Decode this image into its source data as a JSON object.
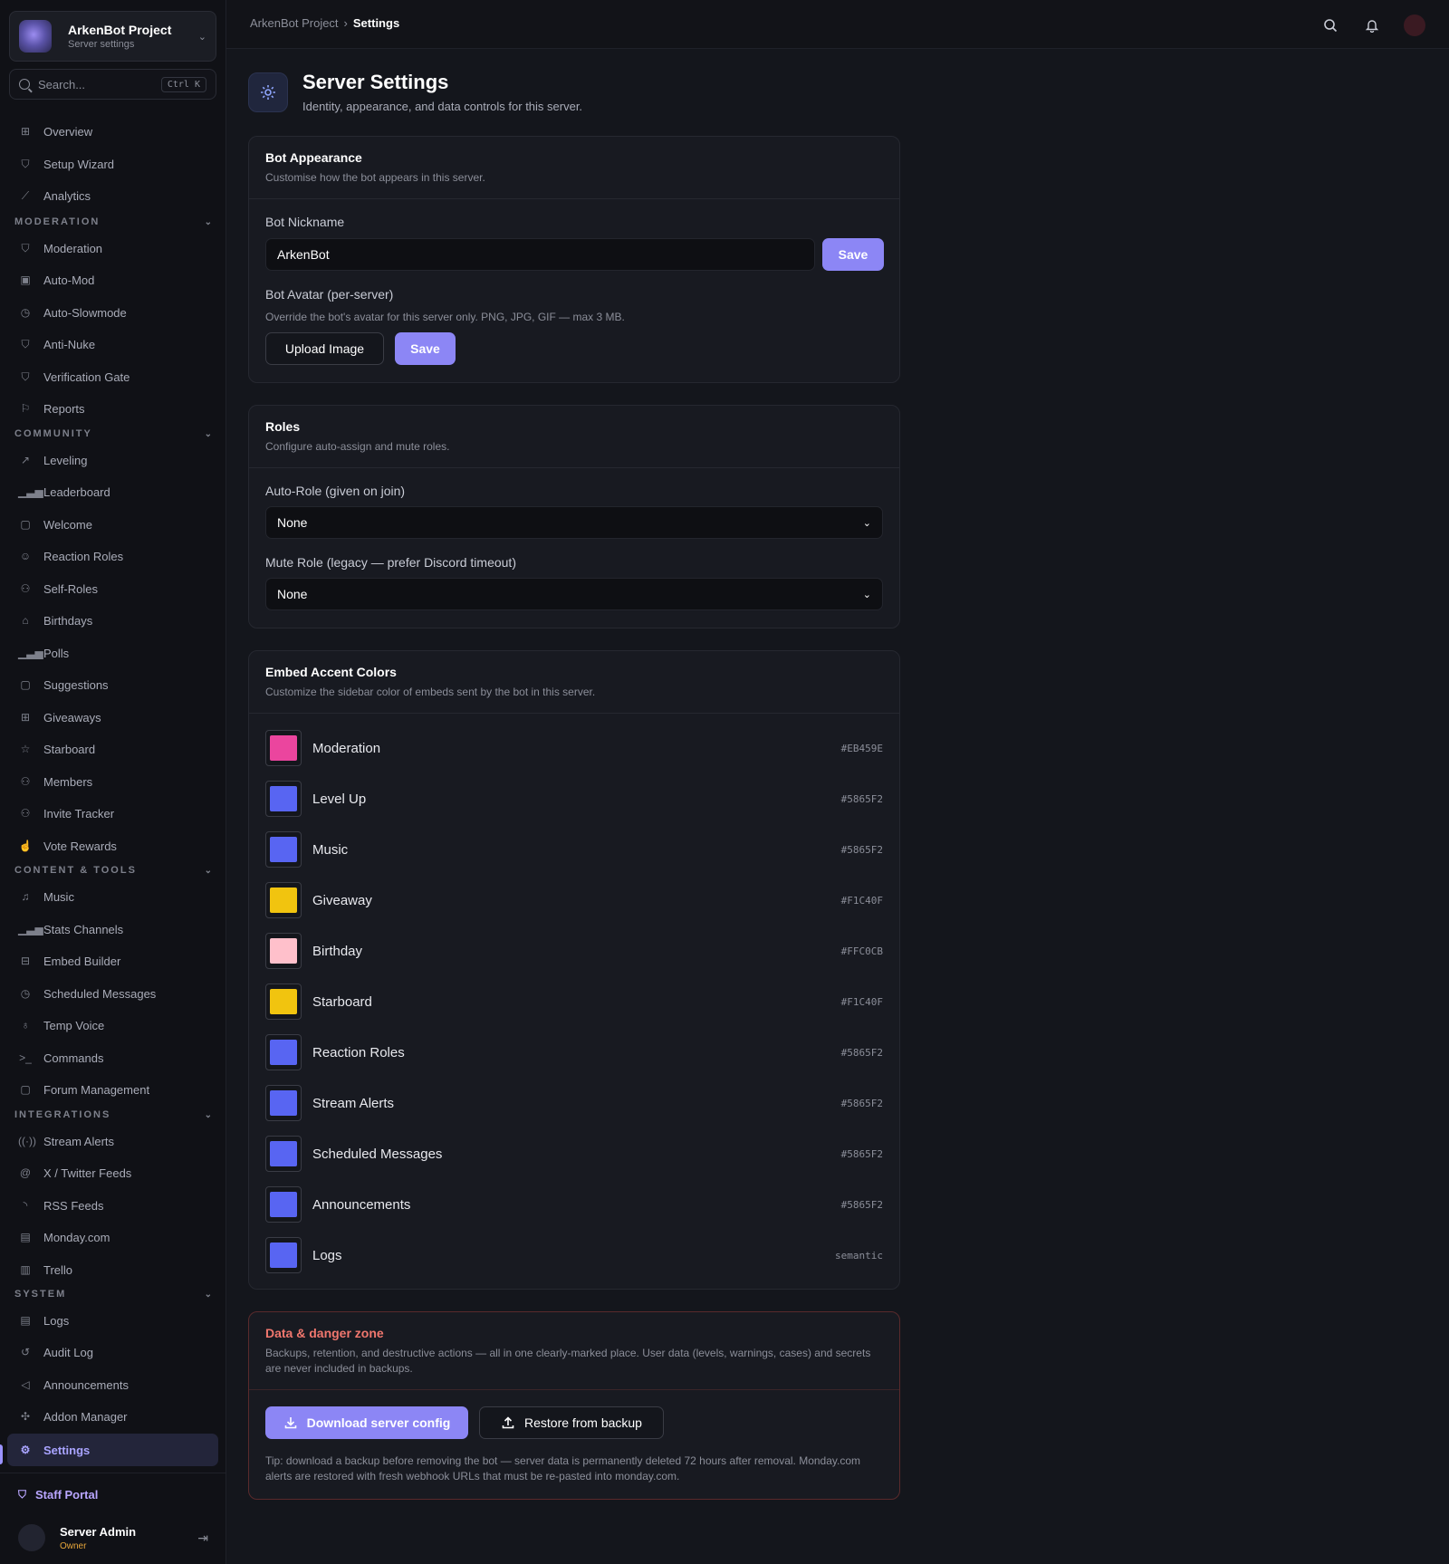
{
  "sidebar": {
    "project_name": "ArkenBot Project",
    "project_sub": "Server settings",
    "search_placeholder": "Search...",
    "search_shortcut": "Ctrl K",
    "top_items": [
      {
        "label": "Overview",
        "icon": "grid-icon"
      },
      {
        "label": "Setup Wizard",
        "icon": "shield-check-icon"
      },
      {
        "label": "Analytics",
        "icon": "chart-line-icon"
      }
    ],
    "sections": {
      "moderation": {
        "title": "MODERATION",
        "items": [
          "Moderation",
          "Auto-Mod",
          "Auto-Slowmode",
          "Anti-Nuke",
          "Verification Gate",
          "Reports"
        ]
      },
      "community": {
        "title": "COMMUNITY",
        "items": [
          "Leveling",
          "Leaderboard",
          "Welcome",
          "Reaction Roles",
          "Self-Roles",
          "Birthdays",
          "Polls",
          "Suggestions",
          "Giveaways",
          "Starboard",
          "Members",
          "Invite Tracker",
          "Vote Rewards"
        ]
      },
      "content": {
        "title": "CONTENT & TOOLS",
        "items": [
          "Music",
          "Stats Channels",
          "Embed Builder",
          "Scheduled Messages",
          "Temp Voice",
          "Commands",
          "Forum Management"
        ]
      },
      "integrations": {
        "title": "INTEGRATIONS",
        "items": [
          "Stream Alerts",
          "X / Twitter Feeds",
          "RSS Feeds",
          "Monday.com",
          "Trello"
        ]
      },
      "system": {
        "title": "SYSTEM",
        "items": [
          "Logs",
          "Audit Log",
          "Announcements",
          "Addon Manager",
          "Settings"
        ]
      }
    },
    "active_item": "Settings",
    "staff_portal": "Staff Portal",
    "user_name": "Server Admin",
    "user_role": "Owner"
  },
  "topbar": {
    "breadcrumb_root": "ArkenBot Project",
    "breadcrumb_current": "Settings"
  },
  "header": {
    "title": "Server Settings",
    "subtitle": "Identity, appearance, and data controls for this server."
  },
  "bot_appearance": {
    "title": "Bot Appearance",
    "subtitle": "Customise how the bot appears in this server.",
    "nickname_label": "Bot Nickname",
    "nickname_value": "ArkenBot",
    "save_label": "Save",
    "avatar_label": "Bot Avatar (per-server)",
    "avatar_hint": "Override the bot's avatar for this server only. PNG, JPG, GIF — max 3 MB.",
    "upload_label": "Upload Image",
    "avatar_save_label": "Save"
  },
  "roles": {
    "title": "Roles",
    "subtitle": "Configure auto-assign and mute roles.",
    "auto_role_label": "Auto-Role (given on join)",
    "auto_role_value": "None",
    "mute_role_label": "Mute Role (legacy — prefer Discord timeout)",
    "mute_role_value": "None"
  },
  "embed_colors": {
    "title": "Embed Accent Colors",
    "subtitle": "Customize the sidebar color of embeds sent by the bot in this server.",
    "items": [
      {
        "name": "Moderation",
        "hex": "#EB459E",
        "color": "#EB459E"
      },
      {
        "name": "Level Up",
        "hex": "#5865F2",
        "color": "#5865F2"
      },
      {
        "name": "Music",
        "hex": "#5865F2",
        "color": "#5865F2"
      },
      {
        "name": "Giveaway",
        "hex": "#F1C40F",
        "color": "#F1C40F"
      },
      {
        "name": "Birthday",
        "hex": "#FFC0CB",
        "color": "#FFC0CB"
      },
      {
        "name": "Starboard",
        "hex": "#F1C40F",
        "color": "#F1C40F"
      },
      {
        "name": "Reaction Roles",
        "hex": "#5865F2",
        "color": "#5865F2"
      },
      {
        "name": "Stream Alerts",
        "hex": "#5865F2",
        "color": "#5865F2"
      },
      {
        "name": "Scheduled Messages",
        "hex": "#5865F2",
        "color": "#5865F2"
      },
      {
        "name": "Announcements",
        "hex": "#5865F2",
        "color": "#5865F2"
      },
      {
        "name": "Logs",
        "hex": "semantic",
        "color": "#5865F2"
      }
    ]
  },
  "danger_zone": {
    "title": "Data & danger zone",
    "subtitle": "Backups, retention, and destructive actions — all in one clearly-marked place. User data (levels, warnings, cases) and secrets are never included in backups.",
    "download_label": "Download server config",
    "restore_label": "Restore from backup",
    "tip": "Tip: download a backup before removing the bot — server data is permanently deleted 72 hours after removal. Monday.com alerts are restored with fresh webhook URLs that must be re-pasted into monday.com."
  },
  "theme": {
    "accent": "#8C86F5",
    "danger": "#F0776E"
  }
}
